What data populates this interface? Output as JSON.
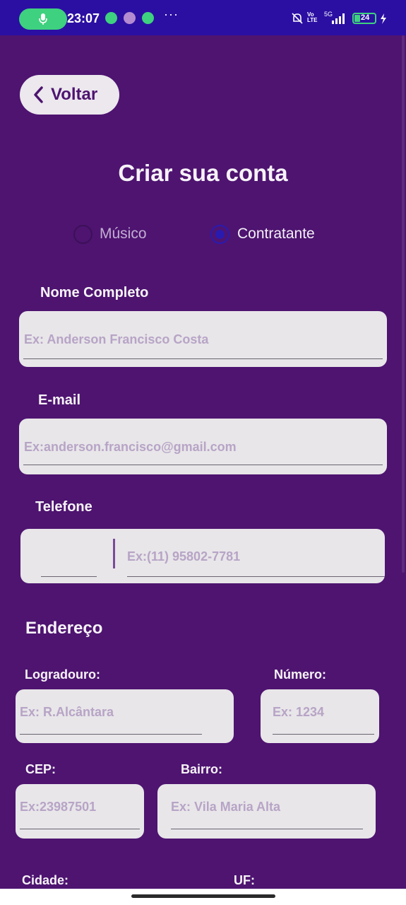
{
  "status_bar": {
    "time": "23:07",
    "dots": "···",
    "network": "5G",
    "volte": "Vo LTE",
    "battery": "24"
  },
  "header": {
    "back_label": "Voltar",
    "title": "Criar sua conta"
  },
  "account_type": {
    "options": [
      "Músico",
      "Contratante"
    ],
    "selected": "Contratante"
  },
  "form": {
    "nome": {
      "label": "Nome Completo",
      "placeholder": "Ex: Anderson Francisco Costa"
    },
    "email": {
      "label": "E-mail",
      "placeholder": "Ex:anderson.francisco@gmail.com"
    },
    "telefone": {
      "label": "Telefone",
      "placeholder": "Ex:(11) 95802-7781"
    },
    "endereco_title": "Endereço",
    "logradouro": {
      "label": "Logradouro:",
      "placeholder": "Ex: R.Alcântara"
    },
    "numero": {
      "label": "Número:",
      "placeholder": "Ex: 1234"
    },
    "cep": {
      "label": "CEP:",
      "placeholder": "Ex:23987501"
    },
    "bairro": {
      "label": "Bairro:",
      "placeholder": "Ex: Vila Maria Alta"
    },
    "cidade": {
      "label": "Cidade:"
    },
    "uf": {
      "label": "UF:"
    }
  },
  "colors": {
    "background": "#4e1470",
    "status_bar": "#2b0fa3",
    "field_bg": "#e8e6e9",
    "placeholder": "#b7a4c6",
    "radio_selected": "#2a1bb0"
  }
}
